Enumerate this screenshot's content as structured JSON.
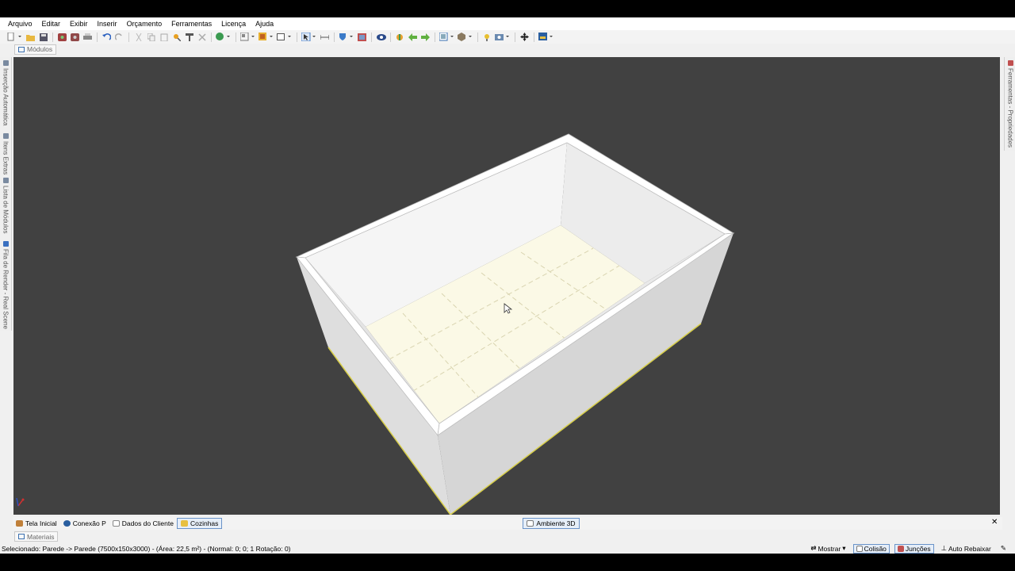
{
  "menu": [
    "Arquivo",
    "Editar",
    "Exibir",
    "Inserir",
    "Orçamento",
    "Ferramentas",
    "Licença",
    "Ajuda"
  ],
  "top_tab": {
    "label": "Módulos"
  },
  "left_tabs": [
    "Inserção Automática",
    "Itens Extras",
    "Lista de Módulos",
    "Fila de Render - Real Scene"
  ],
  "right_tab": "Ferramentas - Propriedades",
  "bottom_tabs": [
    {
      "label": "Tela Inicial",
      "color": "#c0803a"
    },
    {
      "label": "Conexão P",
      "color": "#2a5fa0"
    },
    {
      "label": "Dados do Cliente",
      "color": "#ffffff"
    },
    {
      "label": "Cozinhas",
      "color": "#e8c040"
    }
  ],
  "center_tab": {
    "label": "Ambiente 3D"
  },
  "close_glyph": "✕",
  "materials_tab": {
    "label": "Materiais"
  },
  "status": {
    "text": "Selecionado: Parede -> Parede (7500x150x3000) - (Área: 22,5 m²) - (Normal: 0; 0; 1 Rotação: 0)",
    "mostrar": "Mostrar",
    "colisao": "Colisão",
    "juncoes": "Junções",
    "auto_rebaixar": "Auto Rebaixar"
  },
  "colors": {
    "viewport_bg": "#414141",
    "floor": "#fbf9e6",
    "accent": "#3a6fb0"
  }
}
